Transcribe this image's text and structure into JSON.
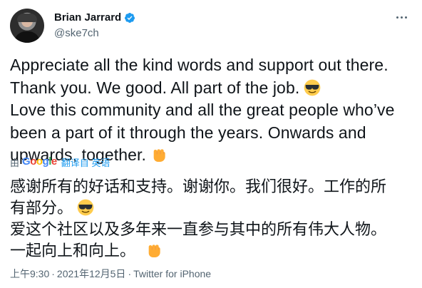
{
  "author": {
    "display_name": "Brian Jarrard",
    "handle": "@ske7ch"
  },
  "tweet": {
    "lines": [
      "Appreciate all the kind words and support out there.",
      "Thank you. We good. All part of the job.",
      "Love this community and all the great people who’ve",
      "been a part of it through the years. Onwards and",
      "upwards, together."
    ],
    "emoji_1": "smiling-face-with-sunglasses",
    "emoji_2": "oncoming-fist"
  },
  "translation": {
    "by_label": "由",
    "provider": "Google",
    "link_label": "翻译自 英语",
    "lines": [
      "感谢所有的好话和支持。谢谢你。我们很好。工作的所",
      "有部分。",
      "爱这个社区以及多年来一直参与其中的所有伟大人物。",
      "一起向上和向上。"
    ]
  },
  "meta": {
    "time": "上午9:30",
    "separator": "·",
    "date": "2021年12月5日",
    "source": "Twitter for iPhone"
  },
  "colors": {
    "text": "#0f1419",
    "secondary": "#536471",
    "accent": "#1d9bf0"
  }
}
